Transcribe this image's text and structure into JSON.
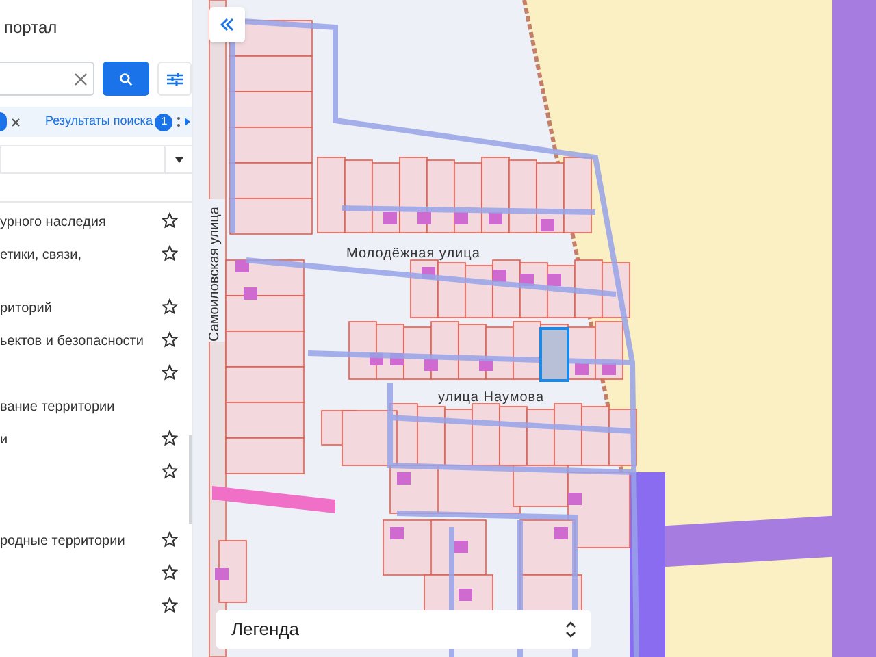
{
  "panel": {
    "title": "портал",
    "tabs": [
      {
        "label": "Результаты поиска",
        "badge": "1"
      }
    ],
    "layers": [
      {
        "label": "урного наследия",
        "kind": "starred"
      },
      {
        "label": "етики, связи,",
        "kind": "starred"
      },
      {
        "label": "риторий",
        "kind": "starred"
      },
      {
        "label": "ьектов и безопасности",
        "kind": "starred"
      },
      {
        "kind": "starred"
      },
      {
        "label": "вание территории",
        "kind": "header"
      },
      {
        "label": "и",
        "kind": "starred"
      },
      {
        "kind": "starred"
      },
      {
        "label": "родные территории",
        "kind": "starred"
      },
      {
        "kind": "starred"
      },
      {
        "kind": "starred"
      }
    ]
  },
  "map": {
    "streets": [
      {
        "name": "Молодёжная улица",
        "kind": "horizontal"
      },
      {
        "name": "улица Наумова",
        "kind": "horizontal"
      },
      {
        "name": "Самоиловская улица",
        "kind": "vertical"
      }
    ],
    "legend": {
      "label": "Легенда"
    }
  }
}
